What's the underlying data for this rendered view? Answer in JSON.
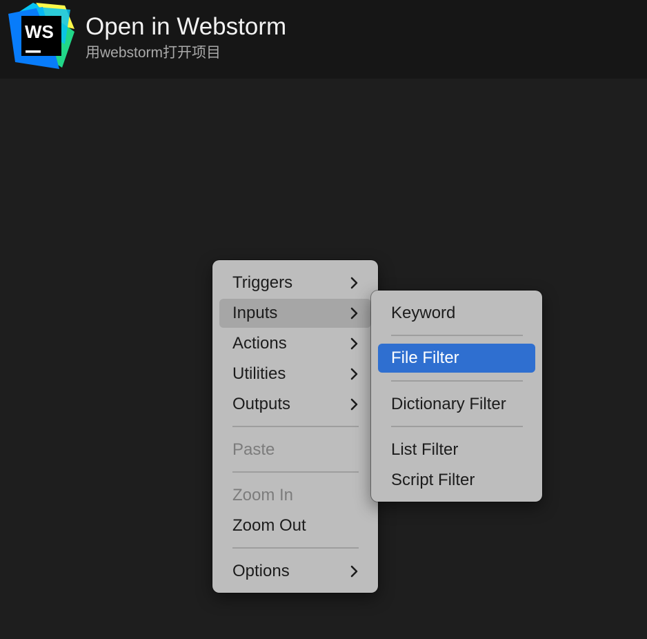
{
  "header": {
    "title": "Open in Webstorm",
    "subtitle": "用webstorm打开项目",
    "logo": {
      "icon": "webstorm-logo",
      "text": "WS",
      "colors": [
        "#21d789",
        "#07c3f2",
        "#087cfa",
        "#fcf84a",
        "#000000"
      ]
    }
  },
  "context_menu": {
    "items": [
      {
        "label": "Triggers",
        "submenu": true
      },
      {
        "label": "Inputs",
        "submenu": true,
        "active": true
      },
      {
        "label": "Actions",
        "submenu": true
      },
      {
        "label": "Utilities",
        "submenu": true
      },
      {
        "label": "Outputs",
        "submenu": true
      },
      {
        "label": "Paste",
        "disabled": true
      },
      {
        "label": "Zoom In",
        "disabled": true
      },
      {
        "label": "Zoom Out"
      },
      {
        "label": "Options",
        "submenu": true
      }
    ]
  },
  "inputs_submenu": {
    "items": [
      {
        "label": "Keyword"
      },
      {
        "label": "File Filter",
        "selected": true
      },
      {
        "label": "Dictionary Filter"
      },
      {
        "label": "List Filter"
      },
      {
        "label": "Script Filter"
      }
    ]
  },
  "colors": {
    "background": "#1e1e1e",
    "header": "#161616",
    "menu": "#bdbdbd",
    "highlight": "#2f6fd0",
    "active_item": "#a6a6a6"
  }
}
